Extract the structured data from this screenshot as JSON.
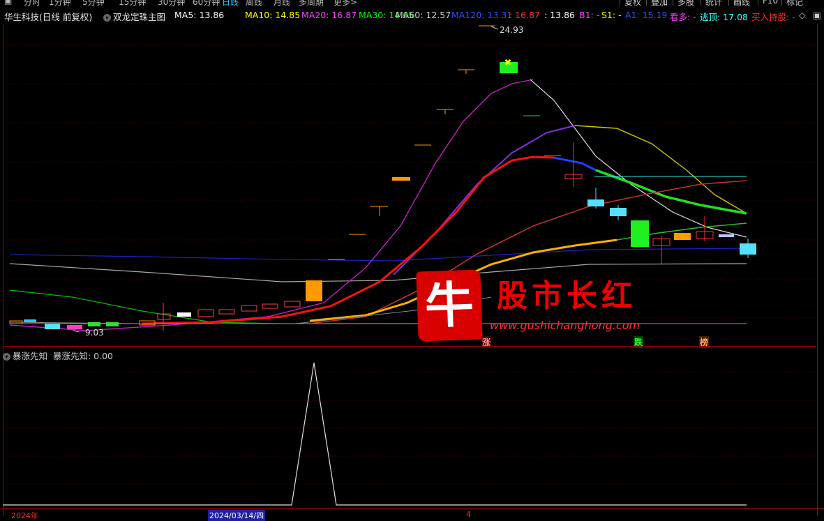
{
  "toolbar": {
    "periods": [
      "分时",
      "1分钟",
      "5分钟",
      "15分钟",
      "30分钟",
      "60分钟",
      "日线",
      "周线",
      "月线",
      "多周期",
      "更多>"
    ],
    "active_period": "日线",
    "right_buttons": [
      "复权",
      "叠加",
      "多股",
      "统计",
      "画线",
      "F10",
      "标记"
    ]
  },
  "main_indicator": {
    "stock": "华生科技(日线 前复权)",
    "formula": "双龙定珠主图",
    "values": [
      {
        "label": "MA5: 13.86",
        "color": "#ffffff"
      },
      {
        "label": "MA10: 14.85",
        "color": "#ffff00"
      },
      {
        "label": "MA20: 16.87",
        "color": "#ff40ff"
      },
      {
        "label": "MA30: 14.65",
        "color": "#00ff00"
      },
      {
        "label": "MA60: 12.57",
        "color": "#cccccc"
      },
      {
        "label": "MA120: 13.31",
        "color": "#3050ff"
      },
      {
        "label": ": 16.87",
        "color": "#ff3030"
      },
      {
        "label": ": 13.86",
        "color": "#ffffff"
      },
      {
        "label": "B1: -",
        "color": "#ff40ff"
      },
      {
        "label": "S1: -",
        "color": "#ffff00"
      },
      {
        "label": "A1: 15.19",
        "color": "#3050ff"
      },
      {
        "label": "看多: -",
        "color": "#ff40ff"
      },
      {
        "label": "逃顶: 17.08",
        "color": "#33ffff"
      },
      {
        "label": "买入持股: -",
        "color": "#ff3030"
      }
    ],
    "high_label": "24.93",
    "low_label": "9.03"
  },
  "sub_indicator": {
    "name": "暴涨先知",
    "value_label": "暴涨先知: 0.00"
  },
  "watermark": {
    "logo_char": "牛",
    "brand": "股市长红",
    "site": "www.gushichanghong.com"
  },
  "tags": [
    "涨",
    "跌",
    "榜"
  ],
  "xaxis": {
    "year": "2024年",
    "cursor_date": "2024/03/14/四",
    "month": "4"
  }
}
